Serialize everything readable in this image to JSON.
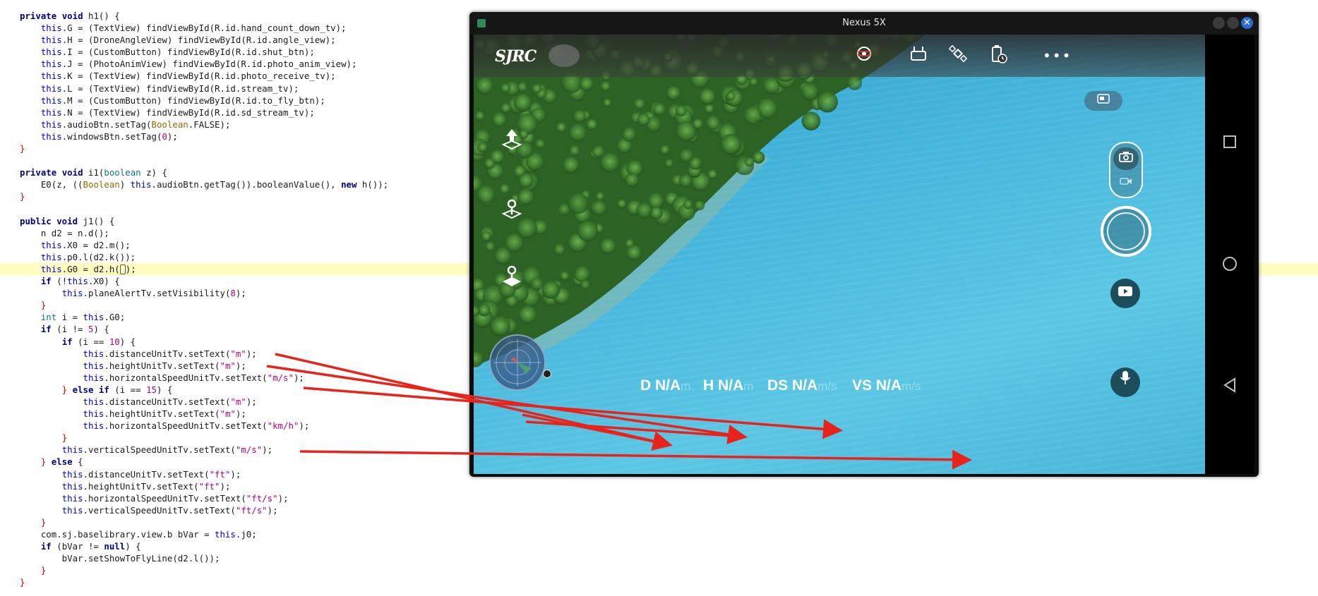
{
  "code_lines": [
    [
      [
        "kwb",
        "private "
      ],
      [
        "kwb",
        "void "
      ],
      [
        "plain",
        "h1() {"
      ]
    ],
    [
      [
        "plain",
        "    "
      ],
      [
        "kw",
        "this"
      ],
      [
        "plain",
        ".G = ("
      ],
      [
        "plain",
        "TextView"
      ],
      [
        "plain",
        ") findViewById(R.id.hand_count_down_tv);"
      ]
    ],
    [
      [
        "plain",
        "    "
      ],
      [
        "kw",
        "this"
      ],
      [
        "plain",
        ".H = ("
      ],
      [
        "plain",
        "DroneAngleView"
      ],
      [
        "plain",
        ") findViewById(R.id.angle_view);"
      ]
    ],
    [
      [
        "plain",
        "    "
      ],
      [
        "kw",
        "this"
      ],
      [
        "plain",
        ".I = ("
      ],
      [
        "plain",
        "CustomButton"
      ],
      [
        "plain",
        ") findViewById(R.id.shut_btn);"
      ]
    ],
    [
      [
        "plain",
        "    "
      ],
      [
        "kw",
        "this"
      ],
      [
        "plain",
        ".J = ("
      ],
      [
        "plain",
        "PhotoAnimView"
      ],
      [
        "plain",
        ") findViewById(R.id.photo_anim_view);"
      ]
    ],
    [
      [
        "plain",
        "    "
      ],
      [
        "kw",
        "this"
      ],
      [
        "plain",
        ".K = ("
      ],
      [
        "plain",
        "TextView"
      ],
      [
        "plain",
        ") findViewById(R.id.photo_receive_tv);"
      ]
    ],
    [
      [
        "plain",
        "    "
      ],
      [
        "kw",
        "this"
      ],
      [
        "plain",
        ".L = ("
      ],
      [
        "plain",
        "TextView"
      ],
      [
        "plain",
        ") findViewById(R.id.stream_tv);"
      ]
    ],
    [
      [
        "plain",
        "    "
      ],
      [
        "kw",
        "this"
      ],
      [
        "plain",
        ".M = ("
      ],
      [
        "plain",
        "CustomButton"
      ],
      [
        "plain",
        ") findViewById(R.id.to_fly_btn);"
      ]
    ],
    [
      [
        "plain",
        "    "
      ],
      [
        "kw",
        "this"
      ],
      [
        "plain",
        ".N = ("
      ],
      [
        "plain",
        "TextView"
      ],
      [
        "plain",
        ") findViewById(R.id.sd_stream_tv);"
      ]
    ],
    [
      [
        "plain",
        "    "
      ],
      [
        "kw",
        "this"
      ],
      [
        "plain",
        ".audioBtn.setTag("
      ],
      [
        "cls",
        "Boolean"
      ],
      [
        "plain",
        ".FALSE);"
      ]
    ],
    [
      [
        "plain",
        "    "
      ],
      [
        "kw",
        "this"
      ],
      [
        "plain",
        ".windowsBtn.setTag("
      ],
      [
        "num",
        "0"
      ],
      [
        "plain",
        ");"
      ]
    ],
    [
      [
        "brace",
        "}"
      ]
    ],
    [],
    [
      [
        "kwb",
        "private "
      ],
      [
        "kwb",
        "void "
      ],
      [
        "plain",
        "i1("
      ],
      [
        "type",
        "boolean "
      ],
      [
        "plain",
        "z) {"
      ]
    ],
    [
      [
        "plain",
        "    E0(z, (("
      ],
      [
        "cls",
        "Boolean"
      ],
      [
        "plain",
        ") "
      ],
      [
        "kw",
        "this"
      ],
      [
        "plain",
        ".audioBtn.getTag()).booleanValue(), "
      ],
      [
        "kwb",
        "new "
      ],
      [
        "plain",
        "h());"
      ]
    ],
    [
      [
        "brace",
        "}"
      ]
    ],
    [],
    [
      [
        "kwb",
        "public "
      ],
      [
        "kwb",
        "void "
      ],
      [
        "plain",
        "j1() {"
      ]
    ],
    [
      [
        "plain",
        "    n d2 = n.d();"
      ]
    ],
    [
      [
        "plain",
        "    "
      ],
      [
        "kw",
        "this"
      ],
      [
        "plain",
        ".X0 = d2.m();"
      ]
    ],
    [
      [
        "plain",
        "    "
      ],
      [
        "kw",
        "this"
      ],
      [
        "plain",
        ".p0.l(d2.k());"
      ]
    ],
    [
      [
        "plain",
        "    "
      ],
      [
        "kw",
        "this"
      ],
      [
        "plain",
        ".G0 = d2.h("
      ],
      [
        "caret",
        ""
      ],
      [
        "plain",
        ");"
      ]
    ],
    [
      [
        "plain",
        "    "
      ],
      [
        "kwb",
        "if "
      ],
      [
        "plain",
        "(!"
      ],
      [
        "kw",
        "this"
      ],
      [
        "plain",
        ".X0) {"
      ]
    ],
    [
      [
        "plain",
        "        "
      ],
      [
        "kw",
        "this"
      ],
      [
        "plain",
        ".planeAlertTv.setVisibility("
      ],
      [
        "num",
        "8"
      ],
      [
        "plain",
        ");"
      ]
    ],
    [
      [
        "plain",
        "    "
      ],
      [
        "brace",
        "}"
      ]
    ],
    [
      [
        "plain",
        "    "
      ],
      [
        "type",
        "int "
      ],
      [
        "plain",
        "i = "
      ],
      [
        "kw",
        "this"
      ],
      [
        "plain",
        ".G0;"
      ]
    ],
    [
      [
        "plain",
        "    "
      ],
      [
        "kwb",
        "if "
      ],
      [
        "plain",
        "(i != "
      ],
      [
        "num",
        "5"
      ],
      [
        "plain",
        ") {"
      ]
    ],
    [
      [
        "plain",
        "        "
      ],
      [
        "kwb",
        "if "
      ],
      [
        "plain",
        "(i == "
      ],
      [
        "num",
        "10"
      ],
      [
        "plain",
        ") {"
      ]
    ],
    [
      [
        "plain",
        "            "
      ],
      [
        "kw",
        "this"
      ],
      [
        "plain",
        ".distanceUnitTv.setText("
      ],
      [
        "str",
        "\"m\""
      ],
      [
        "plain",
        ");"
      ]
    ],
    [
      [
        "plain",
        "            "
      ],
      [
        "kw",
        "this"
      ],
      [
        "plain",
        ".heightUnitTv.setText("
      ],
      [
        "str",
        "\"m\""
      ],
      [
        "plain",
        ");"
      ]
    ],
    [
      [
        "plain",
        "            "
      ],
      [
        "kw",
        "this"
      ],
      [
        "plain",
        ".horizontalSpeedUnitTv.setText("
      ],
      [
        "str",
        "\"m/s\""
      ],
      [
        "plain",
        ");"
      ]
    ],
    [
      [
        "plain",
        "        "
      ],
      [
        "brace",
        "} "
      ],
      [
        "kwb",
        "else if "
      ],
      [
        "plain",
        "(i == "
      ],
      [
        "num",
        "15"
      ],
      [
        "plain",
        ") {"
      ]
    ],
    [
      [
        "plain",
        "            "
      ],
      [
        "kw",
        "this"
      ],
      [
        "plain",
        ".distanceUnitTv.setText("
      ],
      [
        "str",
        "\"m\""
      ],
      [
        "plain",
        ");"
      ]
    ],
    [
      [
        "plain",
        "            "
      ],
      [
        "kw",
        "this"
      ],
      [
        "plain",
        ".heightUnitTv.setText("
      ],
      [
        "str",
        "\"m\""
      ],
      [
        "plain",
        ");"
      ]
    ],
    [
      [
        "plain",
        "            "
      ],
      [
        "kw",
        "this"
      ],
      [
        "plain",
        ".horizontalSpeedUnitTv.setText("
      ],
      [
        "str",
        "\"km/h\""
      ],
      [
        "plain",
        ");"
      ]
    ],
    [
      [
        "plain",
        "        "
      ],
      [
        "brace",
        "}"
      ]
    ],
    [
      [
        "plain",
        "        "
      ],
      [
        "kw",
        "this"
      ],
      [
        "plain",
        ".verticalSpeedUnitTv.setText("
      ],
      [
        "str",
        "\"m/s\""
      ],
      [
        "plain",
        ");"
      ]
    ],
    [
      [
        "plain",
        "    "
      ],
      [
        "brace",
        "} "
      ],
      [
        "kwb",
        "else "
      ],
      [
        "plain",
        "{"
      ]
    ],
    [
      [
        "plain",
        "        "
      ],
      [
        "kw",
        "this"
      ],
      [
        "plain",
        ".distanceUnitTv.setText("
      ],
      [
        "str",
        "\"ft\""
      ],
      [
        "plain",
        ");"
      ]
    ],
    [
      [
        "plain",
        "        "
      ],
      [
        "kw",
        "this"
      ],
      [
        "plain",
        ".heightUnitTv.setText("
      ],
      [
        "str",
        "\"ft\""
      ],
      [
        "plain",
        ");"
      ]
    ],
    [
      [
        "plain",
        "        "
      ],
      [
        "kw",
        "this"
      ],
      [
        "plain",
        ".horizontalSpeedUnitTv.setText("
      ],
      [
        "str",
        "\"ft/s\""
      ],
      [
        "plain",
        ");"
      ]
    ],
    [
      [
        "plain",
        "        "
      ],
      [
        "kw",
        "this"
      ],
      [
        "plain",
        ".verticalSpeedUnitTv.setText("
      ],
      [
        "str",
        "\"ft/s\""
      ],
      [
        "plain",
        ");"
      ]
    ],
    [
      [
        "plain",
        "    "
      ],
      [
        "brace",
        "}"
      ]
    ],
    [
      [
        "plain",
        "    com.sj.baselibrary.view.b bVar = "
      ],
      [
        "kw",
        "this"
      ],
      [
        "plain",
        ".j0;"
      ]
    ],
    [
      [
        "plain",
        "    "
      ],
      [
        "kwb",
        "if "
      ],
      [
        "plain",
        "(bVar != "
      ],
      [
        "kwb",
        "null"
      ],
      [
        "plain",
        ") {"
      ]
    ],
    [
      [
        "plain",
        "        bVar.setShowToFlyLine(d2.l());"
      ]
    ],
    [
      [
        "plain",
        "    "
      ],
      [
        "brace",
        "}"
      ]
    ],
    [
      [
        "brace",
        "}"
      ]
    ]
  ],
  "highlighted_line_index": 21,
  "emulator": {
    "title": "Nexus 5X",
    "app": {
      "brand": "SJRC",
      "top_icons": [
        "gimbal-icon",
        "remote-controller-icon",
        "satellite-icon",
        "battery-icon",
        "more-icon"
      ],
      "more_label": "•••",
      "side_icons": [
        "takeoff-icon",
        "waypoint-icon",
        "joystick-icon"
      ],
      "telemetry": [
        {
          "key": "D",
          "value": "N/A",
          "unit": "m"
        },
        {
          "key": "H",
          "value": "N/A",
          "unit": "m"
        },
        {
          "key": "DS",
          "value": "N/A",
          "unit": "m/s"
        },
        {
          "key": "VS",
          "value": "N/A",
          "unit": "m/s"
        }
      ]
    }
  },
  "colors": {
    "arrow": "#e8231b",
    "highlight": "#fdfdc0",
    "water": "#4ab8dd",
    "forest": "#2f6b2a"
  }
}
